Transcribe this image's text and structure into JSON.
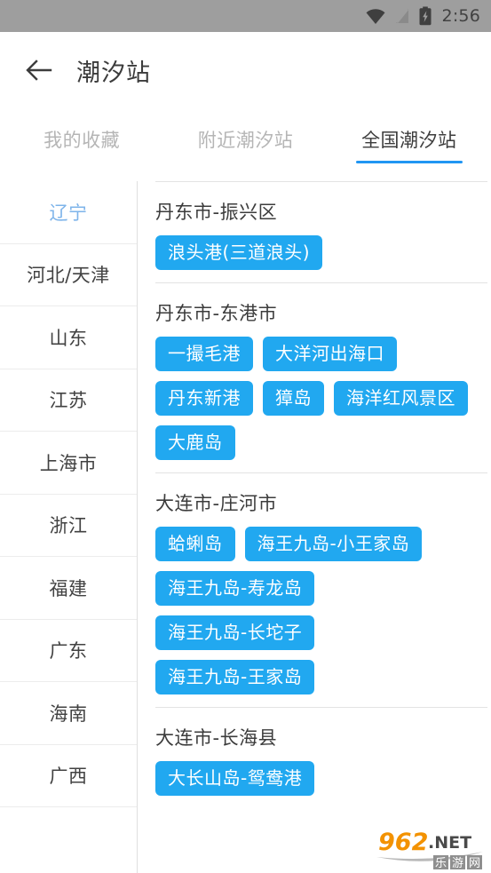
{
  "status_bar": {
    "time": "2:56",
    "background_color": "#9e9e9e",
    "icons": [
      "wifi-icon",
      "cellular-signal-icon",
      "battery-charging-icon"
    ]
  },
  "app_bar": {
    "back_icon": "back-arrow-icon",
    "title": "潮汐站"
  },
  "tabs": {
    "accent_color": "#2196f3",
    "items": [
      {
        "label": "我的收藏",
        "active": false
      },
      {
        "label": "附近潮汐站",
        "active": false
      },
      {
        "label": "全国潮汐站",
        "active": true
      }
    ]
  },
  "sidebar": {
    "active_color": "#7eb4ea",
    "items": [
      {
        "label": "辽宁",
        "active": true
      },
      {
        "label": "河北/天津",
        "active": false
      },
      {
        "label": "山东",
        "active": false
      },
      {
        "label": "江苏",
        "active": false
      },
      {
        "label": "上海市",
        "active": false
      },
      {
        "label": "浙江",
        "active": false
      },
      {
        "label": "福建",
        "active": false
      },
      {
        "label": "广东",
        "active": false
      },
      {
        "label": "海南",
        "active": false
      },
      {
        "label": "广西",
        "active": false
      }
    ]
  },
  "station_list": {
    "tag_color": "#21a8f0",
    "groups": [
      {
        "title": "丹东市-振兴区",
        "stations": [
          "浪头港(三道浪头)"
        ]
      },
      {
        "title": "丹东市-东港市",
        "stations": [
          "一撮毛港",
          "大洋河出海口",
          "丹东新港",
          "獐岛",
          "海洋红风景区",
          "大鹿岛"
        ]
      },
      {
        "title": "大连市-庄河市",
        "stations": [
          "蛤蜊岛",
          "海王九岛-小王家岛",
          "海王九岛-寿龙岛",
          "海王九岛-长坨子",
          "海王九岛-王家岛"
        ]
      },
      {
        "title": "大连市-长海县",
        "stations": [
          "大长山岛-鸳鸯港"
        ]
      }
    ]
  },
  "watermark": {
    "primary_text": "962",
    "domain_text": ".NET",
    "sub_text": "乐游网"
  }
}
